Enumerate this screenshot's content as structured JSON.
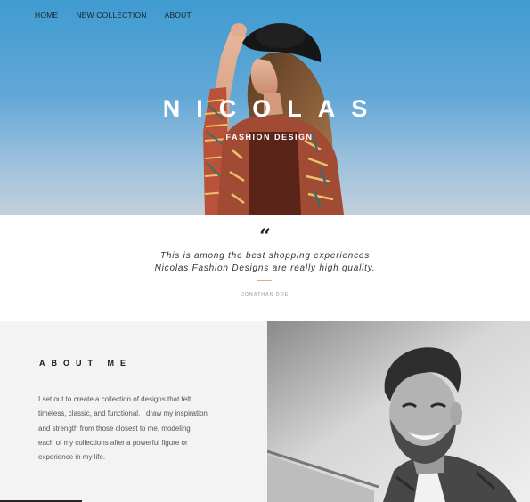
{
  "nav": {
    "items": [
      {
        "label": "HOME"
      },
      {
        "label": "NEW COLLECTION"
      },
      {
        "label": "ABOUT"
      }
    ]
  },
  "hero": {
    "title": "NICOLAS",
    "subtitle": "FASHION DESIGN"
  },
  "testimonial": {
    "quote_mark": "“",
    "line1": "This is among the best shopping experiences",
    "line2": "Nicolas Fashion Designs are really high quality.",
    "author": "JONATHAN DOE"
  },
  "about": {
    "title": "ABOUT ME",
    "lines": [
      "I set out to create a collection of designs that felt",
      "timeless, classic, and functional. I draw my inspiration",
      "and strength from those closest to me, modeling",
      "each of my collections after a powerful figure or",
      "experience in my life."
    ]
  },
  "colors": {
    "sky_top": "#3f9bd1",
    "accent_line": "#e8a99a",
    "about_bg": "#f3f3f3"
  },
  "icons": {
    "quote": "quote-icon"
  }
}
